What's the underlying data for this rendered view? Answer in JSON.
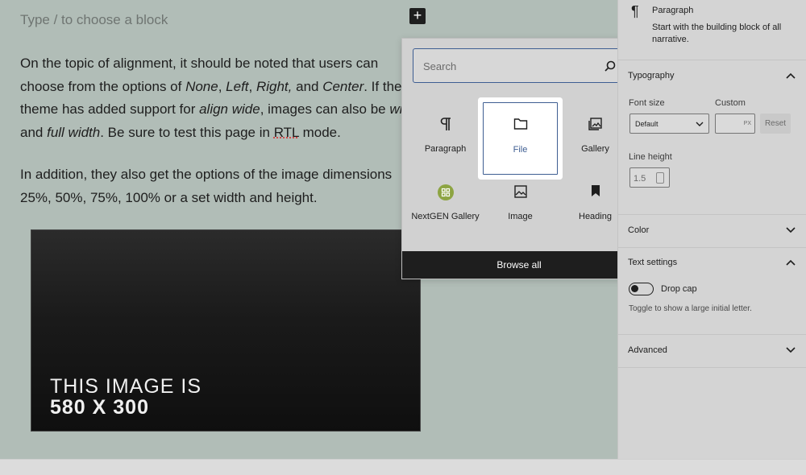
{
  "editor": {
    "placeholder": "Type / to choose a block",
    "para1": [
      {
        "t": "On the topic of alignment, it should be noted that users can"
      },
      {
        "t": "choose from the options of "
      },
      {
        "t": "None",
        "i": true
      },
      {
        "t": ", "
      },
      {
        "t": "Left",
        "i": true
      },
      {
        "t": ", "
      },
      {
        "t": "Right,",
        "i": true
      },
      {
        "t": " and "
      },
      {
        "t": "Center",
        "i": true
      },
      {
        "t": ". If the"
      },
      {
        "t": "theme has added support for "
      },
      {
        "t": "align wide",
        "i": true
      },
      {
        "t": ", images can also be "
      },
      {
        "t": "wide",
        "i": true
      },
      {
        "t": "and "
      },
      {
        "t": "full width",
        "i": true
      },
      {
        "t": ". Be sure to test this page in "
      },
      {
        "t": "RTL",
        "u": true
      },
      {
        "t": " mode."
      }
    ],
    "para1_breaks": [
      0,
      9,
      13
    ],
    "para2_line1": "In addition, they also get the options of the image dimensions",
    "para2_line2": "25%, 50%, 75%, 100% or a set width and height.",
    "image_caption_line1": "THIS IMAGE IS",
    "image_caption_line2": "580 X 300"
  },
  "inserter": {
    "search_placeholder": "Search",
    "blocks": [
      {
        "label": "Paragraph",
        "icon": "paragraph-icon"
      },
      {
        "label": "File",
        "icon": "folder-icon"
      },
      {
        "label": "Gallery",
        "icon": "gallery-icon"
      },
      {
        "label": "NextGEN Gallery",
        "icon": "nextgen-icon"
      },
      {
        "label": "Image",
        "icon": "image-icon"
      },
      {
        "label": "Heading",
        "icon": "bookmark-icon"
      }
    ],
    "browse_all": "Browse all",
    "highlight_color": "#3e5e92"
  },
  "sidebar": {
    "block_title": "Paragraph",
    "block_desc": "Start with the building block of all narrative.",
    "typography": "Typography",
    "font_size_label": "Font size",
    "custom_label": "Custom",
    "font_size_value": "Default",
    "custom_unit": "PX",
    "reset": "Reset",
    "line_height_label": "Line height",
    "line_height_value": "1.5",
    "color": "Color",
    "text_settings": "Text settings",
    "drop_cap": "Drop cap",
    "drop_cap_help": "Toggle to show a large initial letter.",
    "advanced": "Advanced"
  }
}
